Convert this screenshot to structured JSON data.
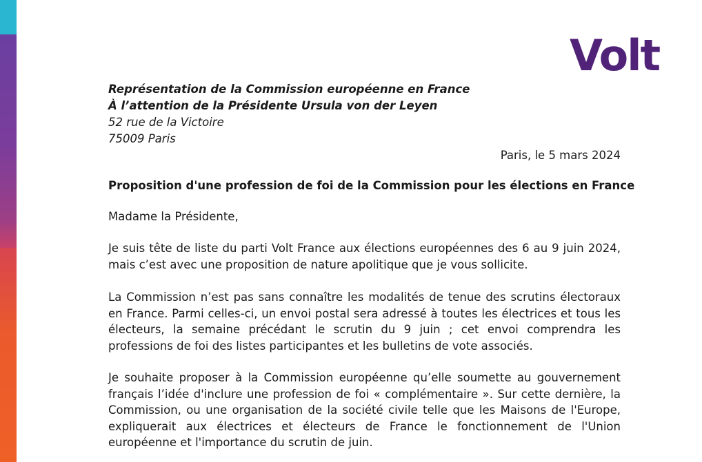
{
  "logo": {
    "text": "Volt",
    "color": "#502379"
  },
  "stripe_colors": [
    "#2ab6d0",
    "#6a3fa0",
    "#c94168",
    "#ef6027"
  ],
  "recipient": {
    "line1": "Représentation de la Commission européenne en France",
    "line2": "À l’attention de la Présidente Ursula von der Leyen",
    "line3": "52 rue de la Victoire",
    "line4": "75009 Paris"
  },
  "date": "Paris, le 5 mars 2024",
  "subject": "Proposition d'une profession de foi de la Commission pour les élections en France",
  "salutation": "Madame la Présidente,",
  "paragraphs": [
    "Je suis tête de liste du parti Volt France aux élections européennes des 6 au 9 juin 2024, mais c’est avec une proposition de nature apolitique que je vous sollicite.",
    "La Commission n’est pas sans connaître les modalités de tenue des scrutins électoraux en France. Parmi celles-ci, un envoi postal sera adressé à toutes les électrices et tous les électeurs, la semaine précédant le scrutin du 9 juin ; cet envoi comprendra les professions de foi des listes participantes et les bulletins de vote associés.",
    "Je souhaite proposer à la Commission européenne qu’elle soumette au gouvernement français l’idée d'inclure une profession de foi « complémentaire ». Sur cette dernière, la Commission, ou une organisation de la société civile telle que les Maisons de l'Europe, expliquerait aux électrices et électeurs de France le fonctionnement de l'Union européenne et l'importance du scrutin de juin."
  ]
}
